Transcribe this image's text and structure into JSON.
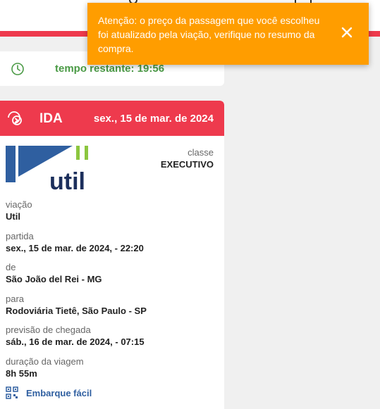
{
  "toast": {
    "message": "Atenção: o preço da passagem que você escolheu foi atualizado pela viação, verifique no resumo da compra.",
    "close_icon": "close-icon",
    "color": "#ff9d00"
  },
  "timer": {
    "icon": "clock-icon",
    "text": "tempo restante: 19:56",
    "color": "#4a9a45"
  },
  "trip": {
    "header_icon": "route-icon",
    "direction": "IDA",
    "date": "sex., 15 de mar. de 2024",
    "header_color": "#ee3a4d",
    "logo_text": "util",
    "class_label": "classe",
    "class_value": "EXECUTIVO",
    "fields": [
      {
        "label": "viação",
        "value": "Util"
      },
      {
        "label": "partida",
        "value": "sex., 15 de mar. de 2024, - 22:20"
      },
      {
        "label": "de",
        "value": "São João del Rei - MG"
      },
      {
        "label": "para",
        "value": "Rodoviária Tietê, São Paulo - SP"
      },
      {
        "label": "previsão de chegada",
        "value": "sáb., 16 de mar. de 2024, - 07:15"
      },
      {
        "label": "duração da viagem",
        "value": "8h 55m"
      }
    ],
    "boarding_icon": "qr-code-icon",
    "boarding_text": "Embarque fácil"
  }
}
